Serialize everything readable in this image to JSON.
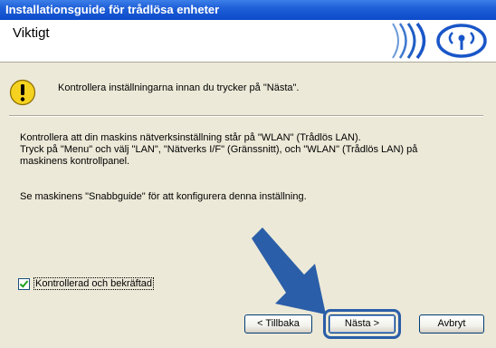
{
  "window": {
    "title": "Installationsguide för trådlösa enheter"
  },
  "header": {
    "title": "Viktigt"
  },
  "warning": {
    "text": "Kontrollera inställningarna innan du trycker på \"Nästa\"."
  },
  "body": {
    "paragraph1_line1": "Kontrollera att din maskins nätverksinställning står på \"WLAN\" (Trådlös LAN).",
    "paragraph1_line2": "Tryck på \"Menu\" och välj \"LAN\", \"Nätverks I/F\" (Gränssnitt), och \"WLAN\" (Trådlös LAN) på",
    "paragraph1_line3": "maskinens kontrollpanel.",
    "paragraph2": "Se maskinens \"Snabbguide\" för att konfigurera denna inställning."
  },
  "checkbox": {
    "label": "Kontrollerad och bekräftad",
    "checked": true
  },
  "buttons": {
    "back": "< Tillbaka",
    "next": "Nästa >",
    "cancel": "Avbryt"
  },
  "icons": {
    "warning": "warning-icon",
    "logo": "wireless-logo-icon",
    "arrow": "pointer-arrow-icon"
  },
  "colors": {
    "titlebar": "#0b4bc9",
    "logo_blue": "#1a56c8",
    "warning_yellow": "#f5d21f",
    "arrow_blue": "#2a5ea8"
  }
}
